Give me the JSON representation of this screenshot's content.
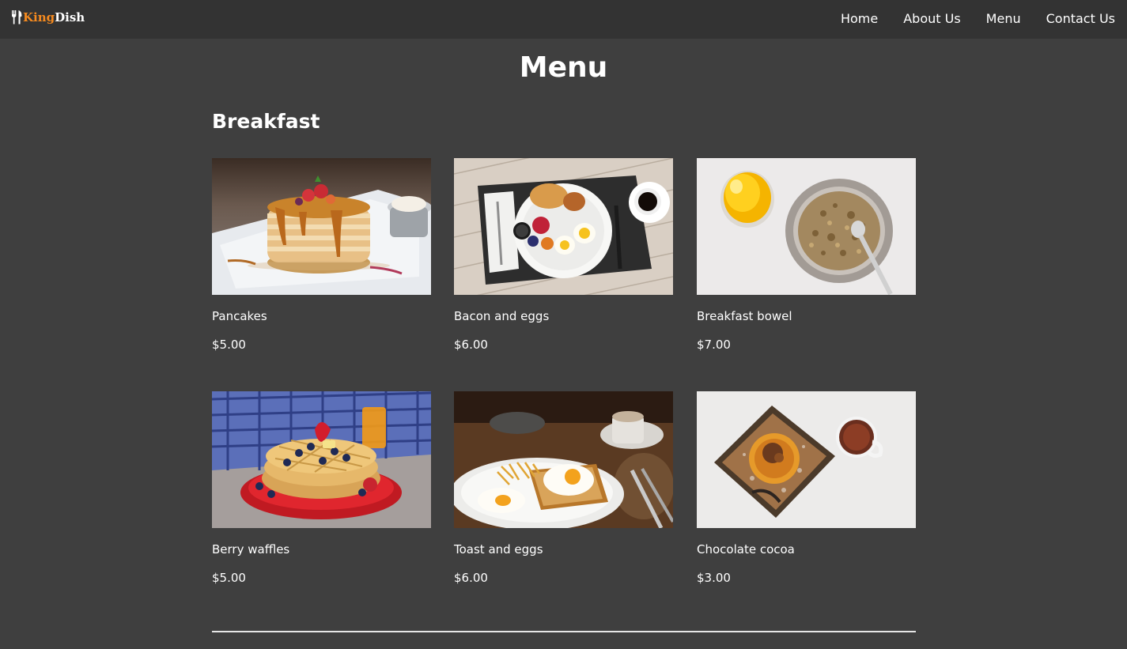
{
  "brand": {
    "part1": "King",
    "part2": "Dish"
  },
  "nav": {
    "items": [
      {
        "label": "Home"
      },
      {
        "label": "About Us"
      },
      {
        "label": "Menu"
      },
      {
        "label": "Contact Us"
      }
    ]
  },
  "page": {
    "title": "Menu"
  },
  "section": {
    "title": "Breakfast",
    "items": [
      {
        "name": "Pancakes",
        "price": "$5.00",
        "image": "pancake-stack"
      },
      {
        "name": "Bacon and eggs",
        "price": "$6.00",
        "image": "breakfast-plate"
      },
      {
        "name": "Breakfast bowel",
        "price": "$7.00",
        "image": "granola-bowl"
      },
      {
        "name": "Berry waffles",
        "price": "$5.00",
        "image": "waffles"
      },
      {
        "name": "Toast and eggs",
        "price": "$6.00",
        "image": "toast-eggs"
      },
      {
        "name": "Chocolate cocoa",
        "price": "$3.00",
        "image": "cocoa-plate"
      }
    ]
  },
  "colors": {
    "background": "#3f3f3f",
    "navbar": "#333333",
    "brand_accent": "#f58a1f",
    "text": "#ffffff"
  }
}
